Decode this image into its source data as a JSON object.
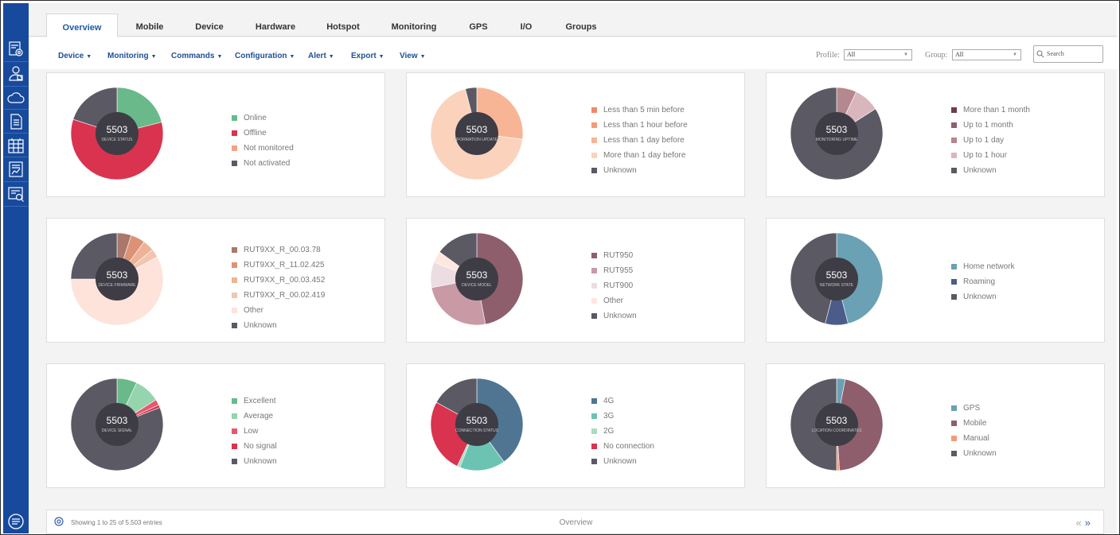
{
  "tabs": [
    "Overview",
    "Mobile",
    "Device",
    "Hardware",
    "Hotspot",
    "Monitoring",
    "GPS",
    "I/O",
    "Groups"
  ],
  "active_tab": "Overview",
  "menus": [
    "Device",
    "Monitoring",
    "Commands",
    "Configuration",
    "Alert",
    "Export",
    "View"
  ],
  "filters": {
    "profile_label": "Profile:",
    "profile_value": "All",
    "group_label": "Group:",
    "group_value": "All",
    "search_placeholder": "Search"
  },
  "panels": [
    {
      "total": "5503",
      "label": "DEVICE STATUS",
      "legend": [
        {
          "text": "Online",
          "color": "#69b98a"
        },
        {
          "text": "Offline",
          "color": "#d9334f"
        },
        {
          "text": "Not monitored",
          "color": "#f3a287"
        },
        {
          "text": "Not activated",
          "color": "#5b5963"
        }
      ]
    },
    {
      "total": "5503",
      "label": "INFORMATION UPDATED",
      "legend": [
        {
          "text": "Less than 5 min before",
          "color": "#ee8a68"
        },
        {
          "text": "Less than 1 hour before",
          "color": "#f39b7b"
        },
        {
          "text": "Less than 1 day before",
          "color": "#f8b595"
        },
        {
          "text": "More than 1 day before",
          "color": "#fbd3bd"
        },
        {
          "text": "Unknown",
          "color": "#5b5963"
        }
      ]
    },
    {
      "total": "5503",
      "label": "MONITORING UPTIME",
      "legend": [
        {
          "text": "More than 1 month",
          "color": "#6e3d4b"
        },
        {
          "text": "Up to 1 month",
          "color": "#915e6e"
        },
        {
          "text": "Up to 1 day",
          "color": "#b5878e"
        },
        {
          "text": "Up to 1 hour",
          "color": "#d9b6bd"
        },
        {
          "text": "Unknown",
          "color": "#5b5963"
        }
      ]
    },
    {
      "total": "5503",
      "label": "DEVICE FIRMWARE",
      "legend": [
        {
          "text": "RUT9XX_R_00.03.78",
          "color": "#a9786a"
        },
        {
          "text": "RUT9XX_R_11.02.425",
          "color": "#dd9277"
        },
        {
          "text": "RUT9XX_R_00.03.452",
          "color": "#eeb397"
        },
        {
          "text": "RUT9XX_R_00.02.419",
          "color": "#f2c5b1"
        },
        {
          "text": "Other",
          "color": "#fde3da"
        },
        {
          "text": "Unknown",
          "color": "#5b5963"
        }
      ]
    },
    {
      "total": "5503",
      "label": "DEVICE MODEL",
      "legend": [
        {
          "text": "RUT950",
          "color": "#8e5e6c"
        },
        {
          "text": "RUT955",
          "color": "#c99aa5"
        },
        {
          "text": "RUT900",
          "color": "#ecdde2"
        },
        {
          "text": "Other",
          "color": "#fde7df"
        },
        {
          "text": "Unknown",
          "color": "#5b5963"
        }
      ]
    },
    {
      "total": "5503",
      "label": "NETWORK STATE",
      "legend": [
        {
          "text": "Home network",
          "color": "#6aa1b4"
        },
        {
          "text": "Roaming",
          "color": "#4b5c8a"
        },
        {
          "text": "Unknown",
          "color": "#5b5963"
        }
      ]
    },
    {
      "total": "5503",
      "label": "DEVICE SIGNAL",
      "legend": [
        {
          "text": "Excellent",
          "color": "#69b98a"
        },
        {
          "text": "Average",
          "color": "#95d4ac"
        },
        {
          "text": "Low",
          "color": "#e8566e"
        },
        {
          "text": "No signal",
          "color": "#d9334f"
        },
        {
          "text": "Unknown",
          "color": "#5b5963"
        }
      ]
    },
    {
      "total": "5503",
      "label": "CONNECTION STATUS",
      "legend": [
        {
          "text": "4G",
          "color": "#4f7592"
        },
        {
          "text": "3G",
          "color": "#6cc3b2"
        },
        {
          "text": "2G",
          "color": "#a8dcc3"
        },
        {
          "text": "No connection",
          "color": "#d9334f"
        },
        {
          "text": "Unknown",
          "color": "#5b5963"
        }
      ]
    },
    {
      "total": "5503",
      "label": "LOCATION COORDINATES",
      "legend": [
        {
          "text": "GPS",
          "color": "#6aa1b4"
        },
        {
          "text": "Mobile",
          "color": "#8e5e6c"
        },
        {
          "text": "Manual",
          "color": "#f39b7b"
        },
        {
          "text": "Unknown",
          "color": "#5b5963"
        }
      ]
    }
  ],
  "chart_data": [
    {
      "type": "pie",
      "title": "DEVICE STATUS",
      "categories": [
        "Online",
        "Offline",
        "Not monitored",
        "Not activated"
      ],
      "values": [
        21,
        59,
        0,
        20
      ]
    },
    {
      "type": "pie",
      "title": "INFORMATION UPDATED",
      "categories": [
        "Less than 5 min before",
        "Less than 1 hour before",
        "Less than 1 day before",
        "More than 1 day before",
        "Unknown"
      ],
      "values": [
        0,
        0,
        27,
        69,
        4
      ]
    },
    {
      "type": "pie",
      "title": "MONITORING UPTIME",
      "categories": [
        "More than 1 month",
        "Up to 1 month",
        "Up to 1 day",
        "Up to 1 hour",
        "Unknown"
      ],
      "values": [
        0,
        0,
        7,
        9,
        84
      ]
    },
    {
      "type": "pie",
      "title": "DEVICE FIRMWARE",
      "categories": [
        "RUT9XX_R_00.03.78",
        "RUT9XX_R_11.02.425",
        "RUT9XX_R_00.03.452",
        "RUT9XX_R_00.02.419",
        "Other",
        "Unknown"
      ],
      "values": [
        5,
        5,
        4,
        3,
        58,
        25
      ]
    },
    {
      "type": "pie",
      "title": "DEVICE MODEL",
      "categories": [
        "RUT950",
        "RUT955",
        "RUT900",
        "Other",
        "Unknown"
      ],
      "values": [
        47,
        25,
        9,
        4,
        15
      ]
    },
    {
      "type": "pie",
      "title": "NETWORK STATE",
      "categories": [
        "Home network",
        "Roaming",
        "Unknown"
      ],
      "values": [
        46,
        8,
        46
      ]
    },
    {
      "type": "pie",
      "title": "DEVICE SIGNAL",
      "categories": [
        "Excellent",
        "Average",
        "Low",
        "No signal",
        "Unknown"
      ],
      "values": [
        7,
        9,
        2,
        1,
        81
      ]
    },
    {
      "type": "pie",
      "title": "CONNECTION STATUS",
      "categories": [
        "4G",
        "3G",
        "2G",
        "No connection",
        "Unknown"
      ],
      "values": [
        40,
        16,
        1,
        26,
        17
      ]
    },
    {
      "type": "pie",
      "title": "LOCATION COORDINATES",
      "categories": [
        "GPS",
        "Mobile",
        "Manual",
        "Unknown"
      ],
      "values": [
        3,
        46,
        1,
        50
      ]
    }
  ],
  "footer": {
    "info": "Showing 1 to 25 of 5,503 entries",
    "title": "Overview",
    "prev": "«",
    "next": "»"
  },
  "sidebar_icons": [
    "dashboard-settings-icon",
    "user-icon",
    "cloud-icon",
    "document-icon",
    "calendar-grid-icon",
    "report-chart-icon",
    "search-report-icon"
  ],
  "bottom_icon": "chat-icon"
}
